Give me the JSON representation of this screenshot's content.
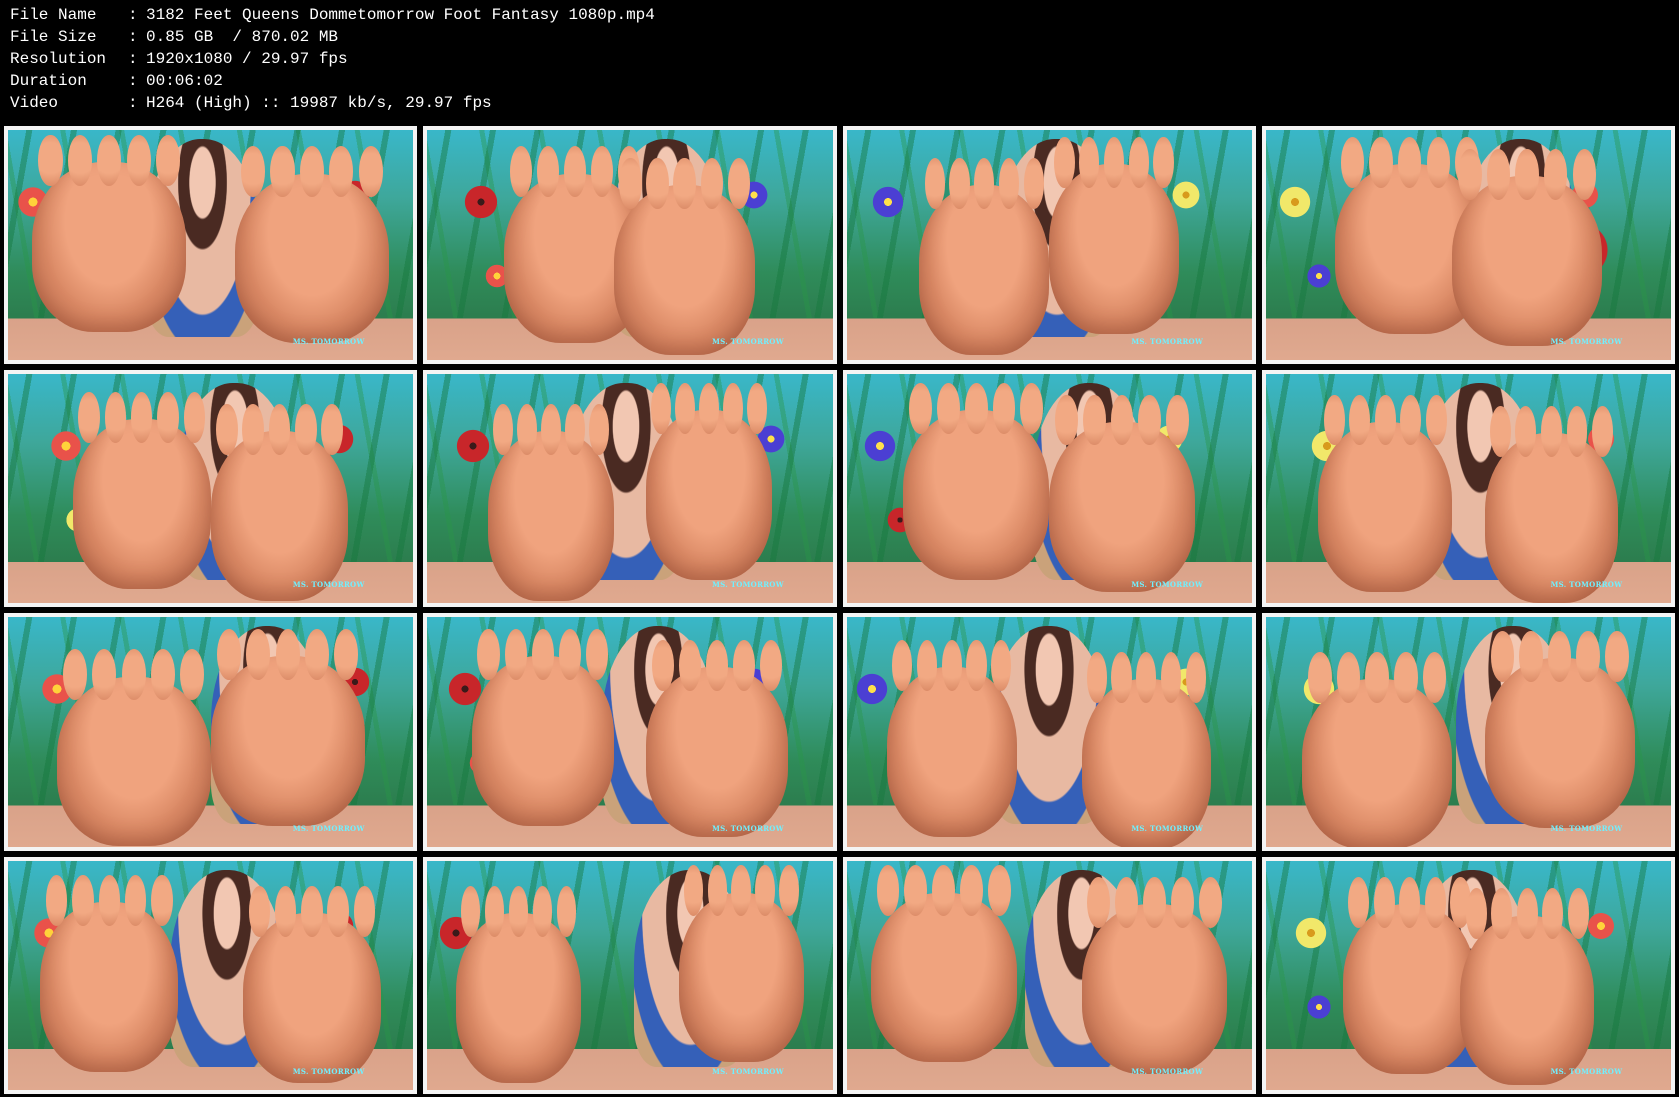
{
  "info": {
    "rows": [
      {
        "label": "File Name",
        "sep": ":",
        "value": "3182 Feet Queens Dommetomorrow Foot Fantasy 1080p.mp4"
      },
      {
        "label": "File Size",
        "sep": ":",
        "value": "0.85 GB  / 870.02 MB"
      },
      {
        "label": "Resolution",
        "sep": ":",
        "value": "1920x1080 / 29.97 fps"
      },
      {
        "label": "Duration",
        "sep": ":",
        "value": "00:06:02"
      },
      {
        "label": "Video",
        "sep": ":",
        "value": "H264 (High) :: 19987 kb/s, 29.97 fps"
      }
    ]
  },
  "thumbnails": {
    "watermark": "MS. TOMORROW",
    "count": 16
  },
  "colors": {
    "background": "#000000",
    "text": "#ffffff",
    "thumb_border": "#f4f4f4",
    "watermark": "#6ff0ff"
  }
}
